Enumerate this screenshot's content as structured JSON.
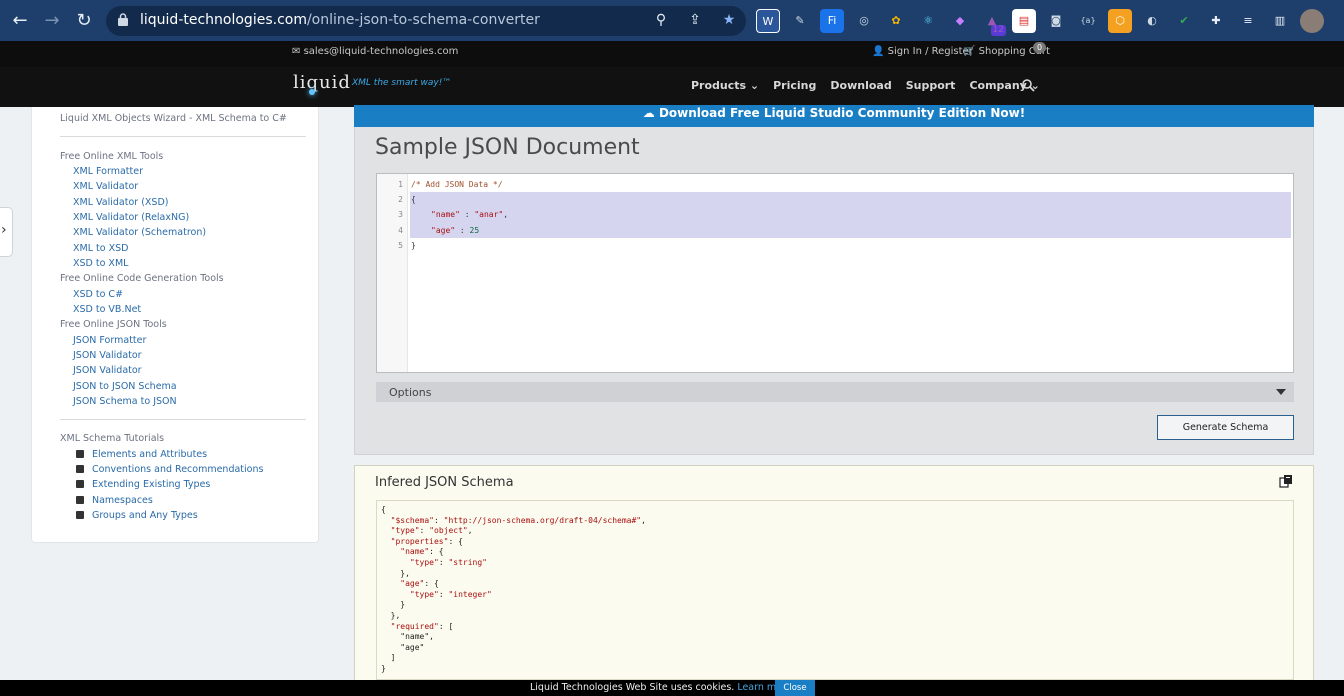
{
  "browser": {
    "url_domain": "liquid-technologies.com",
    "url_path": "/online-json-to-schema-converter",
    "extension_badge": "12"
  },
  "topbar": {
    "email": "sales@liquid-technologies.com",
    "signin": "Sign In / Register",
    "cart": "Shopping Cart",
    "cart_count": "0"
  },
  "header": {
    "logo": "liquid",
    "tagline": "XML the smart way!™",
    "nav": [
      "Products",
      "Pricing",
      "Download",
      "Support",
      "Company"
    ]
  },
  "sidebar": {
    "top_link": "Liquid XML Objects Wizard - XML Schema to C#",
    "sections": [
      {
        "title": "Free Online XML Tools",
        "items": [
          "XML Formatter",
          "XML Validator",
          "XML Validator (XSD)",
          "XML Validator (RelaxNG)",
          "XML Validator (Schematron)",
          "XML to XSD",
          "XSD to XML"
        ]
      },
      {
        "title": "Free Online Code Generation Tools",
        "items": [
          "XSD to C#",
          "XSD to VB.Net"
        ]
      },
      {
        "title": "Free Online JSON Tools",
        "items": [
          "JSON Formatter",
          "JSON Validator",
          "JSON Validator",
          "JSON to JSON Schema",
          "JSON Schema to JSON"
        ]
      }
    ],
    "tutorials_title": "XML Schema Tutorials",
    "tutorials": [
      "Elements and Attributes",
      "Conventions and Recommendations",
      "Extending Existing Types",
      "Namespaces",
      "Groups and Any Types"
    ]
  },
  "banner": {
    "text": "Download Free Liquid Studio Community Edition Now!"
  },
  "sample": {
    "title": "Sample JSON Document",
    "line_numbers": [
      "1",
      "2",
      "3",
      "4",
      "5"
    ],
    "code": {
      "comment": "/* Add JSON Data */",
      "open": "{",
      "name_key": "\"name\"",
      "name_val": "\"anar\"",
      "age_key": "\"age\"",
      "age_val": "25",
      "close": "}"
    },
    "options_label": "Options",
    "generate_button": "Generate Schema"
  },
  "inferred": {
    "title": "Infered JSON Schema",
    "schema_lines": [
      "{",
      "  \"$schema\": \"http://json-schema.org/draft-04/schema#\",",
      "  \"type\": \"object\",",
      "  \"properties\": {",
      "    \"name\": {",
      "      \"type\": \"string\"",
      "    },",
      "    \"age\": {",
      "      \"type\": \"integer\"",
      "    }",
      "  },",
      "  \"required\": [",
      "    \"name\",",
      "    \"age\"",
      "  ]",
      "}"
    ]
  },
  "cookie": {
    "message": "Liquid Technologies Web Site uses cookies.",
    "learn_more": "Learn more.",
    "close": "Close"
  }
}
